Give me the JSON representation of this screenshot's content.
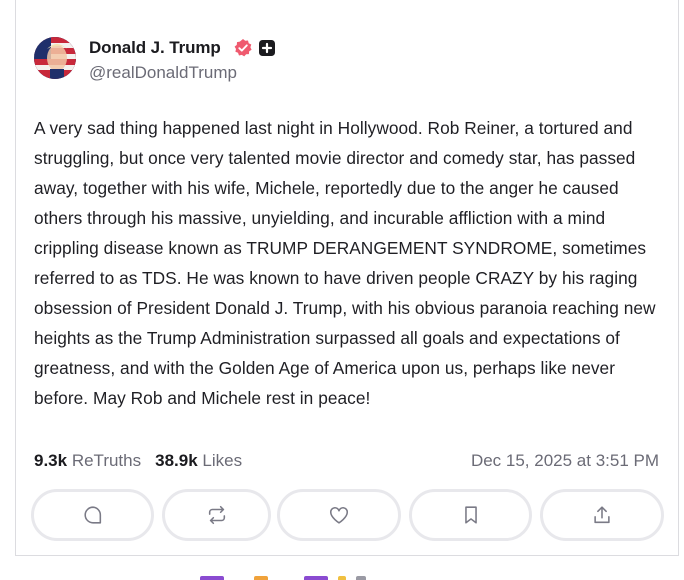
{
  "post": {
    "author_name": "Donald J. Trump",
    "handle": "@realDonaldTrump",
    "body": "A very sad thing happened last night in Hollywood. Rob Reiner, a tortured and struggling, but once very talented movie director and comedy star, has passed away, together with his wife, Michele, reportedly due to the anger he caused others through his massive, unyielding, and incurable affliction with a mind crippling disease known as TRUMP DERANGEMENT SYNDROME, sometimes referred to as TDS. He was known to have driven people CRAZY by his raging obsession of President Donald J. Trump, with his obvious paranoia reaching new heights as the Trump Administration surpassed all goals and expectations of greatness, and with the Golden Age of America upon us, perhaps like never before. May Rob and Michele rest in peace!",
    "retruths_count": "9.3k",
    "retruths_label": "ReTruths",
    "likes_count": "38.9k",
    "likes_label": "Likes",
    "timestamp": "Dec 15, 2025 at 3:51 PM"
  },
  "icons": {
    "verified": "verified-badge-icon",
    "plus": "plus-badge-icon",
    "actions": [
      "reply-icon",
      "retruth-icon",
      "like-icon",
      "bookmark-icon",
      "share-icon"
    ]
  },
  "colors": {
    "verified_badge": "#ef5a6f",
    "muted_text": "#6b6b76",
    "button_border": "#e8e8ec"
  }
}
